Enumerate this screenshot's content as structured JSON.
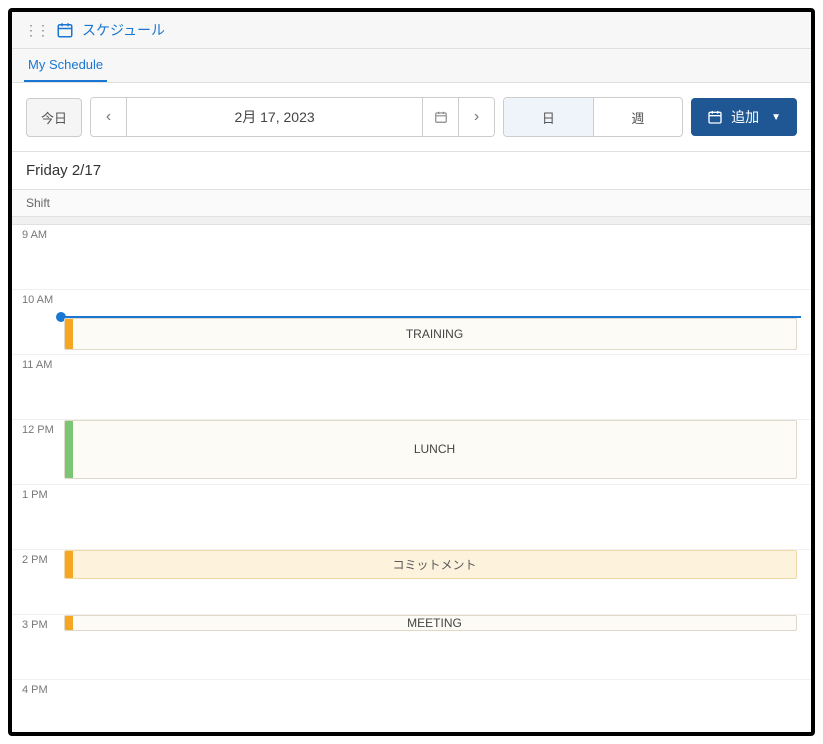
{
  "header": {
    "title": "スケジュール"
  },
  "tabs": {
    "items": [
      {
        "label": "My Schedule",
        "active": true
      }
    ]
  },
  "toolbar": {
    "today": "今日",
    "date": "2月 17, 2023",
    "view_day": "日",
    "view_week": "週",
    "add": "追加"
  },
  "day": {
    "label": "Friday 2/17",
    "shift_label": "Shift"
  },
  "hours": [
    "9 AM",
    "10 AM",
    "11 AM",
    "12 PM",
    "1 PM",
    "2 PM",
    "3 PM",
    "4 PM"
  ],
  "now": {
    "hour_index": 1,
    "fraction": 0.4
  },
  "events": [
    {
      "title": "TRAINING",
      "start_index": 1,
      "start_fraction": 0.43,
      "duration_rows": 0.5,
      "color": "orange",
      "style": "normal"
    },
    {
      "title": "LUNCH",
      "start_index": 3,
      "start_fraction": 0.0,
      "duration_rows": 0.9,
      "color": "green",
      "style": "normal"
    },
    {
      "title": "コミットメント",
      "start_index": 5,
      "start_fraction": 0.0,
      "duration_rows": 0.45,
      "color": "orange",
      "style": "commit"
    },
    {
      "title": "MEETING",
      "start_index": 6,
      "start_fraction": 0.0,
      "duration_rows": 0.25,
      "color": "orange",
      "style": "normal"
    }
  ]
}
